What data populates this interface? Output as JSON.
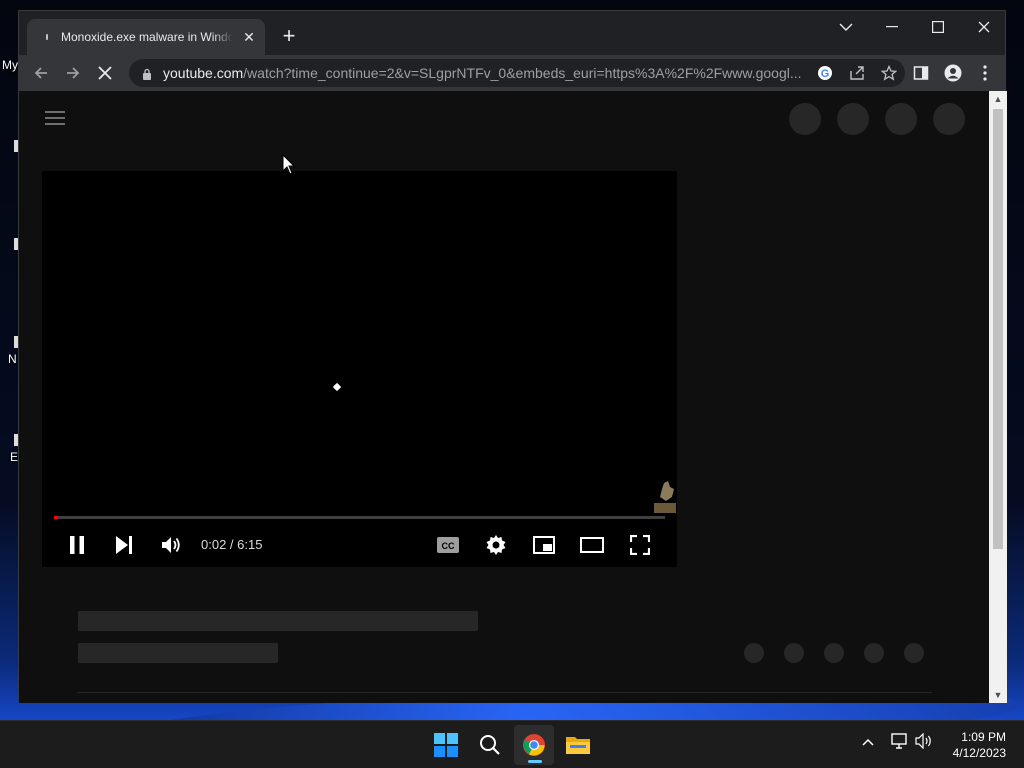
{
  "desktop": {
    "labels": [
      "My",
      "N",
      "E"
    ]
  },
  "browser": {
    "tab": {
      "title": "Monoxide.exe malware in Windows"
    },
    "new_tab_symbol": "+",
    "window_controls": {
      "tab_search": "⌵",
      "minimize": "─",
      "maximize": "☐",
      "close": "✕"
    },
    "url": {
      "host": "youtube.com",
      "rest": "/watch?time_continue=2&v=SLgprNTFv_0&embeds_euri=https%3A%2F%2Fwww.googl..."
    },
    "toolbar_icons": [
      "google-icon",
      "share-icon",
      "star-icon",
      "side-panel-icon",
      "profile-icon",
      "menu-icon"
    ]
  },
  "player": {
    "current_time": "0:02",
    "separator": " / ",
    "duration": "6:15",
    "progress": 0.005,
    "progress_color": "#ff0000"
  },
  "taskbar": {
    "time": "1:09 PM",
    "date": "4/12/2023",
    "apps": [
      "start-icon",
      "search-icon",
      "chrome-icon",
      "file-explorer-icon"
    ]
  }
}
